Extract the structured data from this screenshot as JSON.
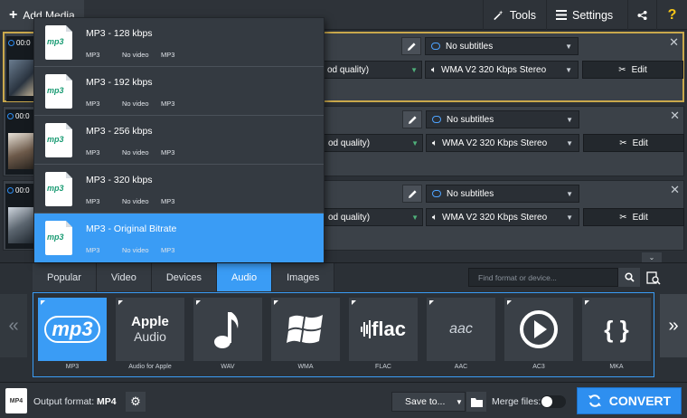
{
  "toolbar": {
    "add_media_label": "Add Media",
    "tools_label": "Tools",
    "settings_label": "Settings",
    "help_label": "?"
  },
  "file_rows": [
    {
      "time": "00:0",
      "subtitles": "No subtitles",
      "quality": "od quality)",
      "audio": "WMA V2 320 Kbps Stereo",
      "edit_label": "Edit"
    },
    {
      "time": "00:0",
      "subtitles": "No subtitles",
      "quality": "od quality)",
      "audio": "WMA V2 320 Kbps Stereo",
      "edit_label": "Edit"
    },
    {
      "time": "00:0",
      "subtitles": "No subtitles",
      "quality": "od quality)",
      "audio": "WMA V2 320 Kbps Stereo",
      "edit_label": "Edit"
    }
  ],
  "preset_menu": {
    "items": [
      {
        "title": "MP3 - 128 kbps",
        "icon_text": "mp3",
        "col1": "MP3",
        "col2": "No video",
        "col3": "MP3"
      },
      {
        "title": "MP3 - 192 kbps",
        "icon_text": "mp3",
        "col1": "MP3",
        "col2": "No video",
        "col3": "MP3"
      },
      {
        "title": "MP3 - 256 kbps",
        "icon_text": "mp3",
        "col1": "MP3",
        "col2": "No video",
        "col3": "MP3"
      },
      {
        "title": "MP3 - 320 kbps",
        "icon_text": "mp3",
        "col1": "MP3",
        "col2": "No video",
        "col3": "MP3"
      },
      {
        "title": "MP3 - Original Bitrate",
        "icon_text": "mp3",
        "col1": "MP3",
        "col2": "No video",
        "col3": "MP3"
      }
    ],
    "active_index": 4
  },
  "format_panel": {
    "tabs": [
      "Popular",
      "Video",
      "Devices",
      "Audio",
      "Images"
    ],
    "active_tab": "Audio",
    "search_placeholder": "Find format or device...",
    "formats": [
      {
        "label": "MP3",
        "logo": "mp3"
      },
      {
        "label": "Audio for Apple",
        "logo_line1": "Apple",
        "logo_line2": "Audio"
      },
      {
        "label": "WAV"
      },
      {
        "label": "WMA"
      },
      {
        "label": "FLAC",
        "logo": "flac"
      },
      {
        "label": "AAC",
        "logo": "aac"
      },
      {
        "label": "AC3"
      },
      {
        "label": "MKA",
        "logo": "{ }"
      }
    ],
    "nav_left": "«",
    "nav_right": "»",
    "collapse": "⌄"
  },
  "bottom_bar": {
    "output_icon_text": "MP4",
    "output_label": "Output format:",
    "output_value": "MP4",
    "save_to_label": "Save to...",
    "merge_label": "Merge files:",
    "merge_on": false,
    "convert_label": "CONVERT"
  },
  "colors": {
    "accent": "#3a9cf5",
    "selected_border": "#c9a84c",
    "background": "#2b3036"
  }
}
